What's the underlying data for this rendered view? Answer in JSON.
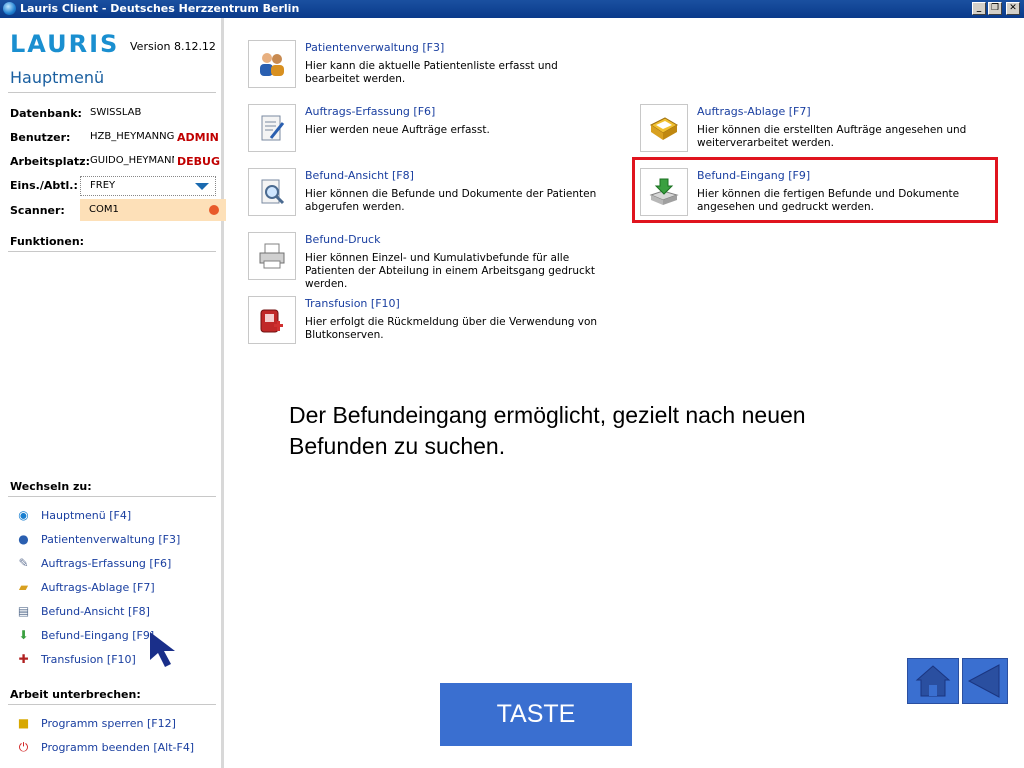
{
  "window": {
    "title": "Lauris Client - Deutsches Herzzentrum Berlin",
    "minimize": "_",
    "restore": "❐",
    "close": "✕"
  },
  "sidebar": {
    "logo": "LAURIS",
    "version": "Version 8.12.12",
    "heading": "Hauptmenü",
    "fields": {
      "datenbank_label": "Datenbank:",
      "datenbank_value": "SWISSLAB",
      "benutzer_label": "Benutzer:",
      "benutzer_value": "HZB_HEYMANNG",
      "benutzer_tag": "ADMIN",
      "arbeitsplatz_label": "Arbeitsplatz:",
      "arbeitsplatz_value": "GUIDO_HEYMANN",
      "arbeitsplatz_tag": "DEBUG",
      "eins_label": "Eins./Abtl.:",
      "eins_value": "FREY",
      "scanner_label": "Scanner:",
      "scanner_value": "COM1"
    },
    "funktionen": "Funktionen:",
    "wechseln": "Wechseln zu:",
    "nav": [
      {
        "label": "Hauptmenü [F4]",
        "icon": "home-globe-icon"
      },
      {
        "label": "Patientenverwaltung [F3]",
        "icon": "patient-icon"
      },
      {
        "label": "Auftrags-Erfassung [F6]",
        "icon": "order-entry-icon"
      },
      {
        "label": "Auftrags-Ablage [F7]",
        "icon": "order-tray-icon"
      },
      {
        "label": "Befund-Ansicht [F8]",
        "icon": "report-view-icon"
      },
      {
        "label": "Befund-Eingang [F9]",
        "icon": "report-inbox-icon"
      },
      {
        "label": "Transfusion [F10]",
        "icon": "transfusion-icon"
      }
    ],
    "unterbrechen": "Arbeit unterbrechen:",
    "actions": [
      {
        "label": "Programm sperren [F12]",
        "icon": "lock-icon"
      },
      {
        "label": "Programm beenden [Alt-F4]",
        "icon": "power-icon"
      }
    ]
  },
  "tiles": {
    "patient": {
      "title": "Patientenverwaltung [F3]",
      "desc": "Hier kann die aktuelle Patientenliste erfasst und bearbeitet werden."
    },
    "erfassung": {
      "title": "Auftrags-Erfassung [F6]",
      "desc": "Hier werden neue Aufträge erfasst."
    },
    "ablage": {
      "title": "Auftrags-Ablage [F7]",
      "desc": "Hier können die erstellten Aufträge angesehen und weiterverarbeitet werden."
    },
    "ansicht": {
      "title": "Befund-Ansicht [F8]",
      "desc": "Hier können die Befunde und Dokumente der Patienten abgerufen werden."
    },
    "eingang": {
      "title": "Befund-Eingang [F9]",
      "desc": "Hier können die fertigen Befunde und Dokumente angesehen und gedruckt werden."
    },
    "druck": {
      "title": "Befund-Druck",
      "desc": "Hier können Einzel- und Kumulativbefunde für alle Patienten der Abteilung in einem Arbeitsgang gedruckt werden."
    },
    "transfusion": {
      "title": "Transfusion [F10]",
      "desc": "Hier erfolgt die Rückmeldung über die Verwendung von Blutkonserven."
    }
  },
  "caption": "Der Befundeingang ermöglicht, gezielt nach neuen Befunden zu suchen.",
  "taste_label": "TASTE",
  "colors": {
    "accent": "#3a6fd0",
    "highlight": "#e0141e",
    "link": "#1a3fa0",
    "tag": "#c00000"
  }
}
